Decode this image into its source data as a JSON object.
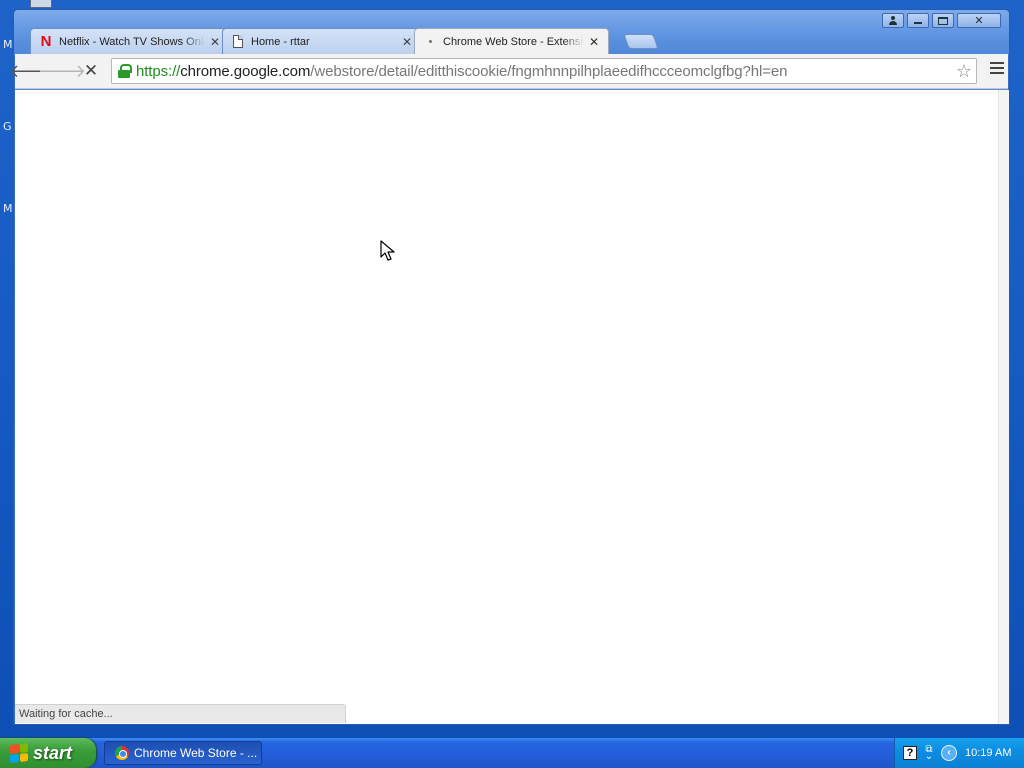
{
  "desktop": {
    "edge_letters": [
      "M",
      "G",
      "M"
    ]
  },
  "window": {
    "controls": [
      "user-icon",
      "minimize-icon",
      "maximize-icon",
      "close-icon"
    ]
  },
  "tabs": [
    {
      "title": "Netflix - Watch TV Shows Online",
      "favicon": "netflix-icon"
    },
    {
      "title": "Home - rttar",
      "favicon": "page-icon"
    },
    {
      "title": "Chrome Web Store - Extensions",
      "favicon": "loading-icon",
      "active": true
    }
  ],
  "toolbar": {
    "url_scheme": "https://",
    "url_host": "chrome.google.com",
    "url_path": "/webstore/detail/editthiscookie/fngmhnnpilhplaeedifhccceomclgfbg?hl=en"
  },
  "status": {
    "text": "Waiting for cache..."
  },
  "taskbar": {
    "start_label": "start",
    "task_label": "Chrome Web Store - ...",
    "clock": "10:19 AM"
  },
  "colors": {
    "accent": "#245edb",
    "start_green": "#3a9d3a",
    "secure_green": "#1d8f1d"
  }
}
